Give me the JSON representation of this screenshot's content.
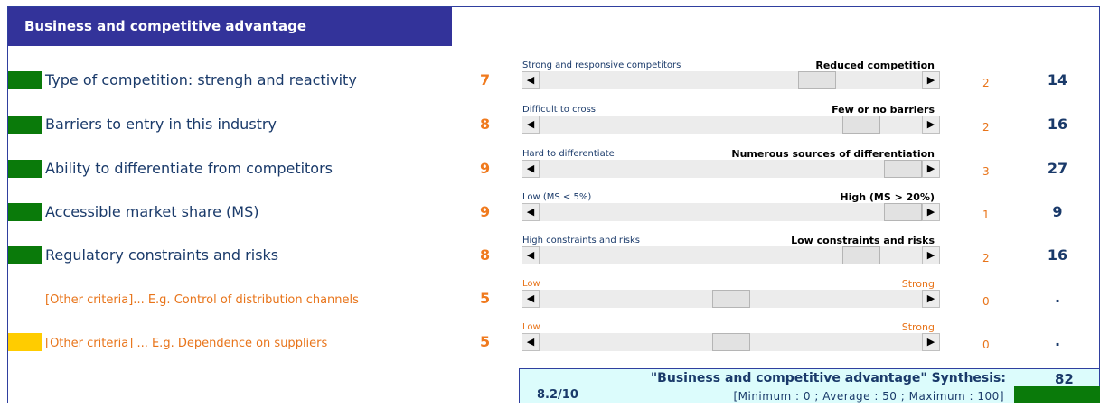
{
  "header": {
    "title": "Business and competitive advantage"
  },
  "colors": {
    "green": "#0a7a0a",
    "yellow": "#ffcc00",
    "orange": "#f07a1e",
    "navy": "#1a3a6a",
    "header_bg": "#33339a"
  },
  "rows": [
    {
      "label": "Type of competition: strengh and reactivity",
      "score": "7",
      "left_caption": "Strong and responsive competitors",
      "right_caption": "Reduced competition",
      "slider_level": 0.75,
      "weight": "2",
      "total": "14",
      "indicator": "green",
      "other": false
    },
    {
      "label": "Barriers to entry in this industry",
      "score": "8",
      "left_caption": "Difficult to cross",
      "right_caption": "Few or no barriers",
      "slider_level": 0.88,
      "weight": "2",
      "total": "16",
      "indicator": "green",
      "other": false
    },
    {
      "label": "Ability to differentiate from competitors",
      "score": "9",
      "left_caption": "Hard to differentiate",
      "right_caption": "Numerous sources of differentiation",
      "slider_level": 1.0,
      "weight": "3",
      "total": "27",
      "indicator": "green",
      "other": false
    },
    {
      "label": "Accessible market share (MS)",
      "score": "9",
      "left_caption": "Low (MS < 5%)",
      "right_caption": "High (MS > 20%)",
      "slider_level": 1.0,
      "weight": "1",
      "total": "9",
      "indicator": "green",
      "other": false
    },
    {
      "label": "Regulatory constraints and risks",
      "score": "8",
      "left_caption": "High constraints and risks",
      "right_caption": "Low constraints and risks",
      "slider_level": 0.88,
      "weight": "2",
      "total": "16",
      "indicator": "green",
      "other": false
    },
    {
      "label": "[Other criteria]... E.g. Control of distribution channels",
      "score": "5",
      "left_caption": "Low",
      "right_caption": "Strong",
      "slider_level": 0.5,
      "weight": "0",
      "total": ".",
      "indicator": "none",
      "other": true
    },
    {
      "label": "[Other criteria] ... E.g. Dependence on suppliers",
      "score": "5",
      "left_caption": "Low",
      "right_caption": "Strong",
      "slider_level": 0.5,
      "weight": "0",
      "total": ".",
      "indicator": "yellow",
      "other": true
    }
  ],
  "synthesis": {
    "title": "\"Business and competitive advantage\" Synthesis:",
    "score": "82",
    "rating": "8.2/10",
    "range": "[Minimum : 0 ; Average : 50 ; Maximum : 100]"
  }
}
